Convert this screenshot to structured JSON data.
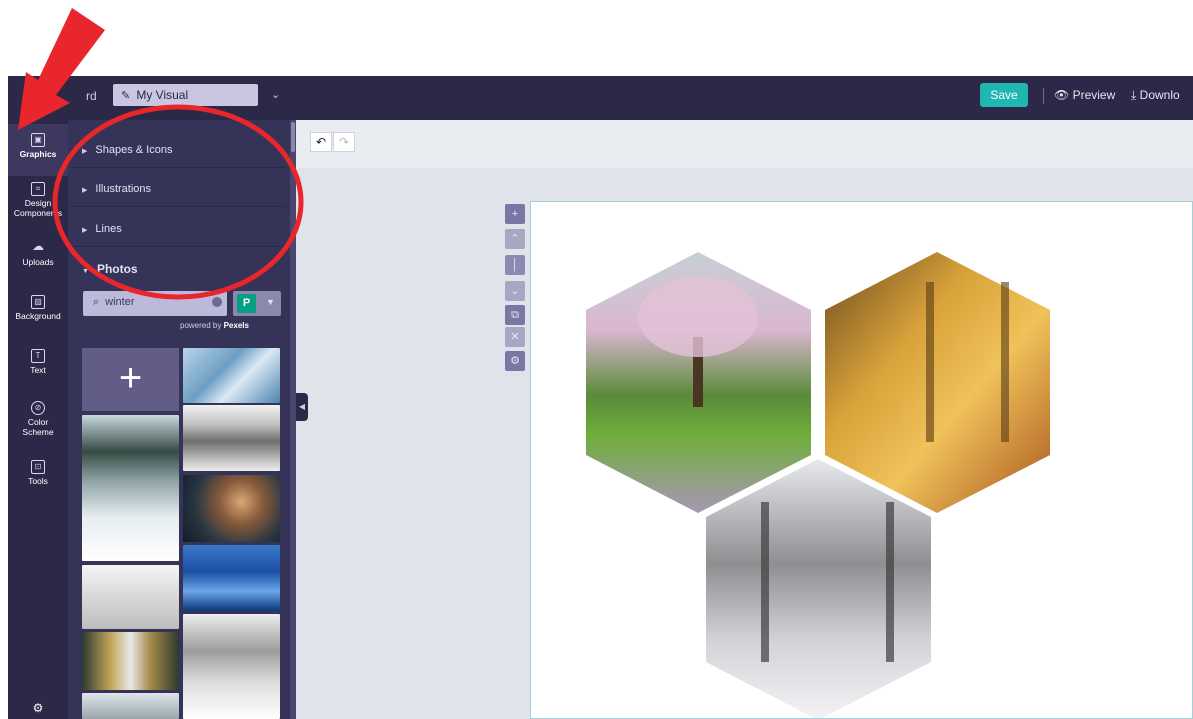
{
  "topbar": {
    "crumb": "rd",
    "title": "My Visual",
    "save_label": "Save",
    "preview_label": "Preview",
    "download_label": "Downlo"
  },
  "rail": {
    "items": [
      {
        "label": "Graphics",
        "icon": "graphics-icon"
      },
      {
        "label": "Design Components",
        "icon": "design-components-icon"
      },
      {
        "label": "Uploads",
        "icon": "cloud-upload-icon"
      },
      {
        "label": "Background",
        "icon": "background-icon"
      },
      {
        "label": "Text",
        "icon": "text-icon"
      },
      {
        "label": "Color Scheme",
        "icon": "palette-icon"
      },
      {
        "label": "Tools",
        "icon": "toolbox-icon"
      }
    ]
  },
  "panel": {
    "sections": [
      "Shapes & Icons",
      "Illustrations",
      "Lines",
      "Photos"
    ],
    "search_value": "winter",
    "pexels_letter": "P",
    "powered_prefix": "powered by",
    "powered_brand": "Pexels"
  },
  "colors": {
    "accent": "#1fb7b0",
    "dark": "#2b2848",
    "panel": "#363359",
    "annotation": "#e8262c"
  }
}
